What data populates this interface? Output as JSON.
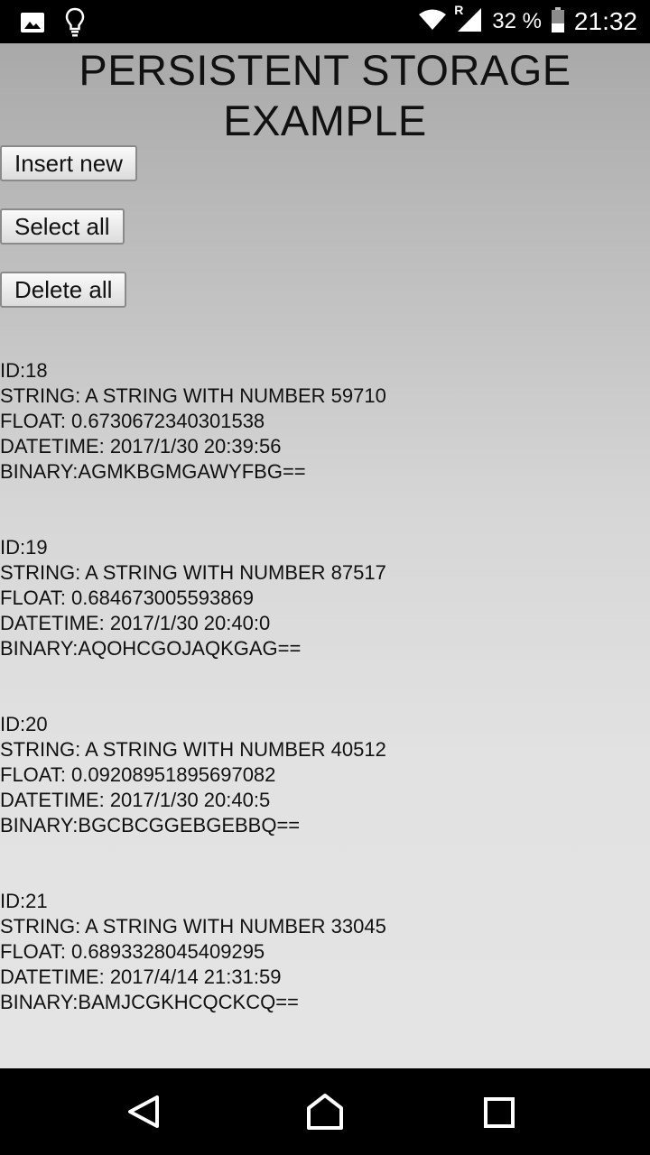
{
  "status_bar": {
    "left_icons": [
      "image-icon",
      "lightbulb-icon"
    ],
    "right_icons": [
      "wifi-icon",
      "signal-icon",
      "battery-icon"
    ],
    "roaming": "R",
    "battery_percent": "32 %",
    "time": "21:32"
  },
  "app": {
    "title_line1": "PERSISTENT STORAGE",
    "title_line2": "EXAMPLE",
    "buttons": {
      "insert_label": "Insert new",
      "select_label": "Select all",
      "delete_label": "Delete all"
    },
    "records": [
      {
        "id": "ID:18",
        "string": "STRING: A STRING WITH NUMBER 59710",
        "float": "FLOAT: 0.6730672340301538",
        "datetime": "DATETIME: 2017/1/30 20:39:56",
        "binary": "BINARY:AGMKBGMGAWYFBG=="
      },
      {
        "id": "ID:19",
        "string": "STRING: A STRING WITH NUMBER 87517",
        "float": "FLOAT: 0.684673005593869",
        "datetime": "DATETIME: 2017/1/30 20:40:0",
        "binary": "BINARY:AQOHCGOJAQKGAG=="
      },
      {
        "id": "ID:20",
        "string": "STRING: A STRING WITH NUMBER 40512",
        "float": "FLOAT: 0.09208951895697082",
        "datetime": "DATETIME: 2017/1/30 20:40:5",
        "binary": "BINARY:BGCBCGGEBGEBBQ=="
      },
      {
        "id": "ID:21",
        "string": "STRING: A STRING WITH NUMBER 33045",
        "float": "FLOAT: 0.6893328045409295",
        "datetime": "DATETIME: 2017/4/14 21:31:59",
        "binary": "BINARY:BAMJCGKHCQCKCQ=="
      }
    ]
  },
  "nav_bar": {
    "buttons": [
      "back-icon",
      "home-icon",
      "recents-icon"
    ]
  }
}
